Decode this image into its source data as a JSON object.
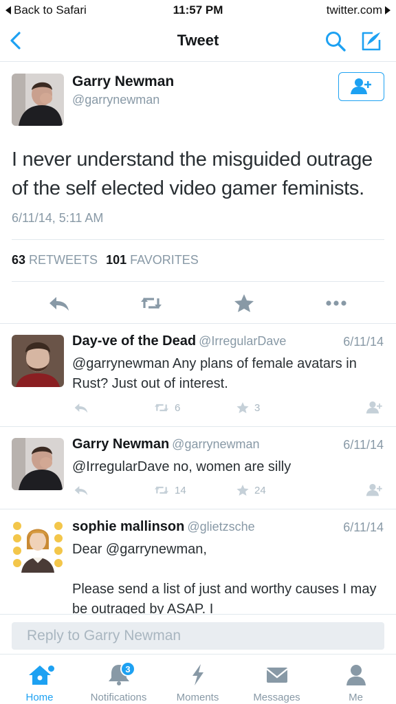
{
  "status_bar": {
    "back_label": "Back to Safari",
    "time": "11:57 PM",
    "site": "twitter.com"
  },
  "nav": {
    "title": "Tweet",
    "back_icon": "chevron-left-icon",
    "search_icon": "search-icon",
    "compose_icon": "compose-icon"
  },
  "tweet": {
    "name": "Garry Newman",
    "handle": "@garrynewman",
    "text": "I never understand the misguided outrage of the self elected video gamer feminists.",
    "date": "6/11/14, 5:11 AM",
    "retweets_count": "63",
    "retweets_label": "RETWEETS",
    "favorites_count": "101",
    "favorites_label": "FAVORITES"
  },
  "replies": [
    {
      "name": "Day-ve of the Dead",
      "handle": "@IrregularDave",
      "date": "6/11/14",
      "text": "@garrynewman Any plans of female avatars in Rust? Just out of interest.",
      "retweets": "6",
      "likes": "3"
    },
    {
      "name": "Garry Newman",
      "handle": "@garrynewman",
      "date": "6/11/14",
      "text": "@IrregularDave no, women are silly",
      "retweets": "14",
      "likes": "24"
    },
    {
      "name": "sophie mallinson",
      "handle": "@glietzsche",
      "date": "6/11/14",
      "text": "Dear @garrynewman,\n\nPlease send a list of just and worthy causes I may be outraged by ASAP. I"
    }
  ],
  "reply_bar": {
    "placeholder": "Reply to Garry Newman"
  },
  "tabs": [
    {
      "label": "Home",
      "icon": "home-icon"
    },
    {
      "label": "Notifications",
      "icon": "bell-icon",
      "badge": "3"
    },
    {
      "label": "Moments",
      "icon": "lightning-icon"
    },
    {
      "label": "Messages",
      "icon": "envelope-icon"
    },
    {
      "label": "Me",
      "icon": "person-icon"
    }
  ],
  "colors": {
    "accent": "#1da1f2",
    "secondary_text": "#8899a6",
    "icon_gray": "#aab8c2"
  }
}
